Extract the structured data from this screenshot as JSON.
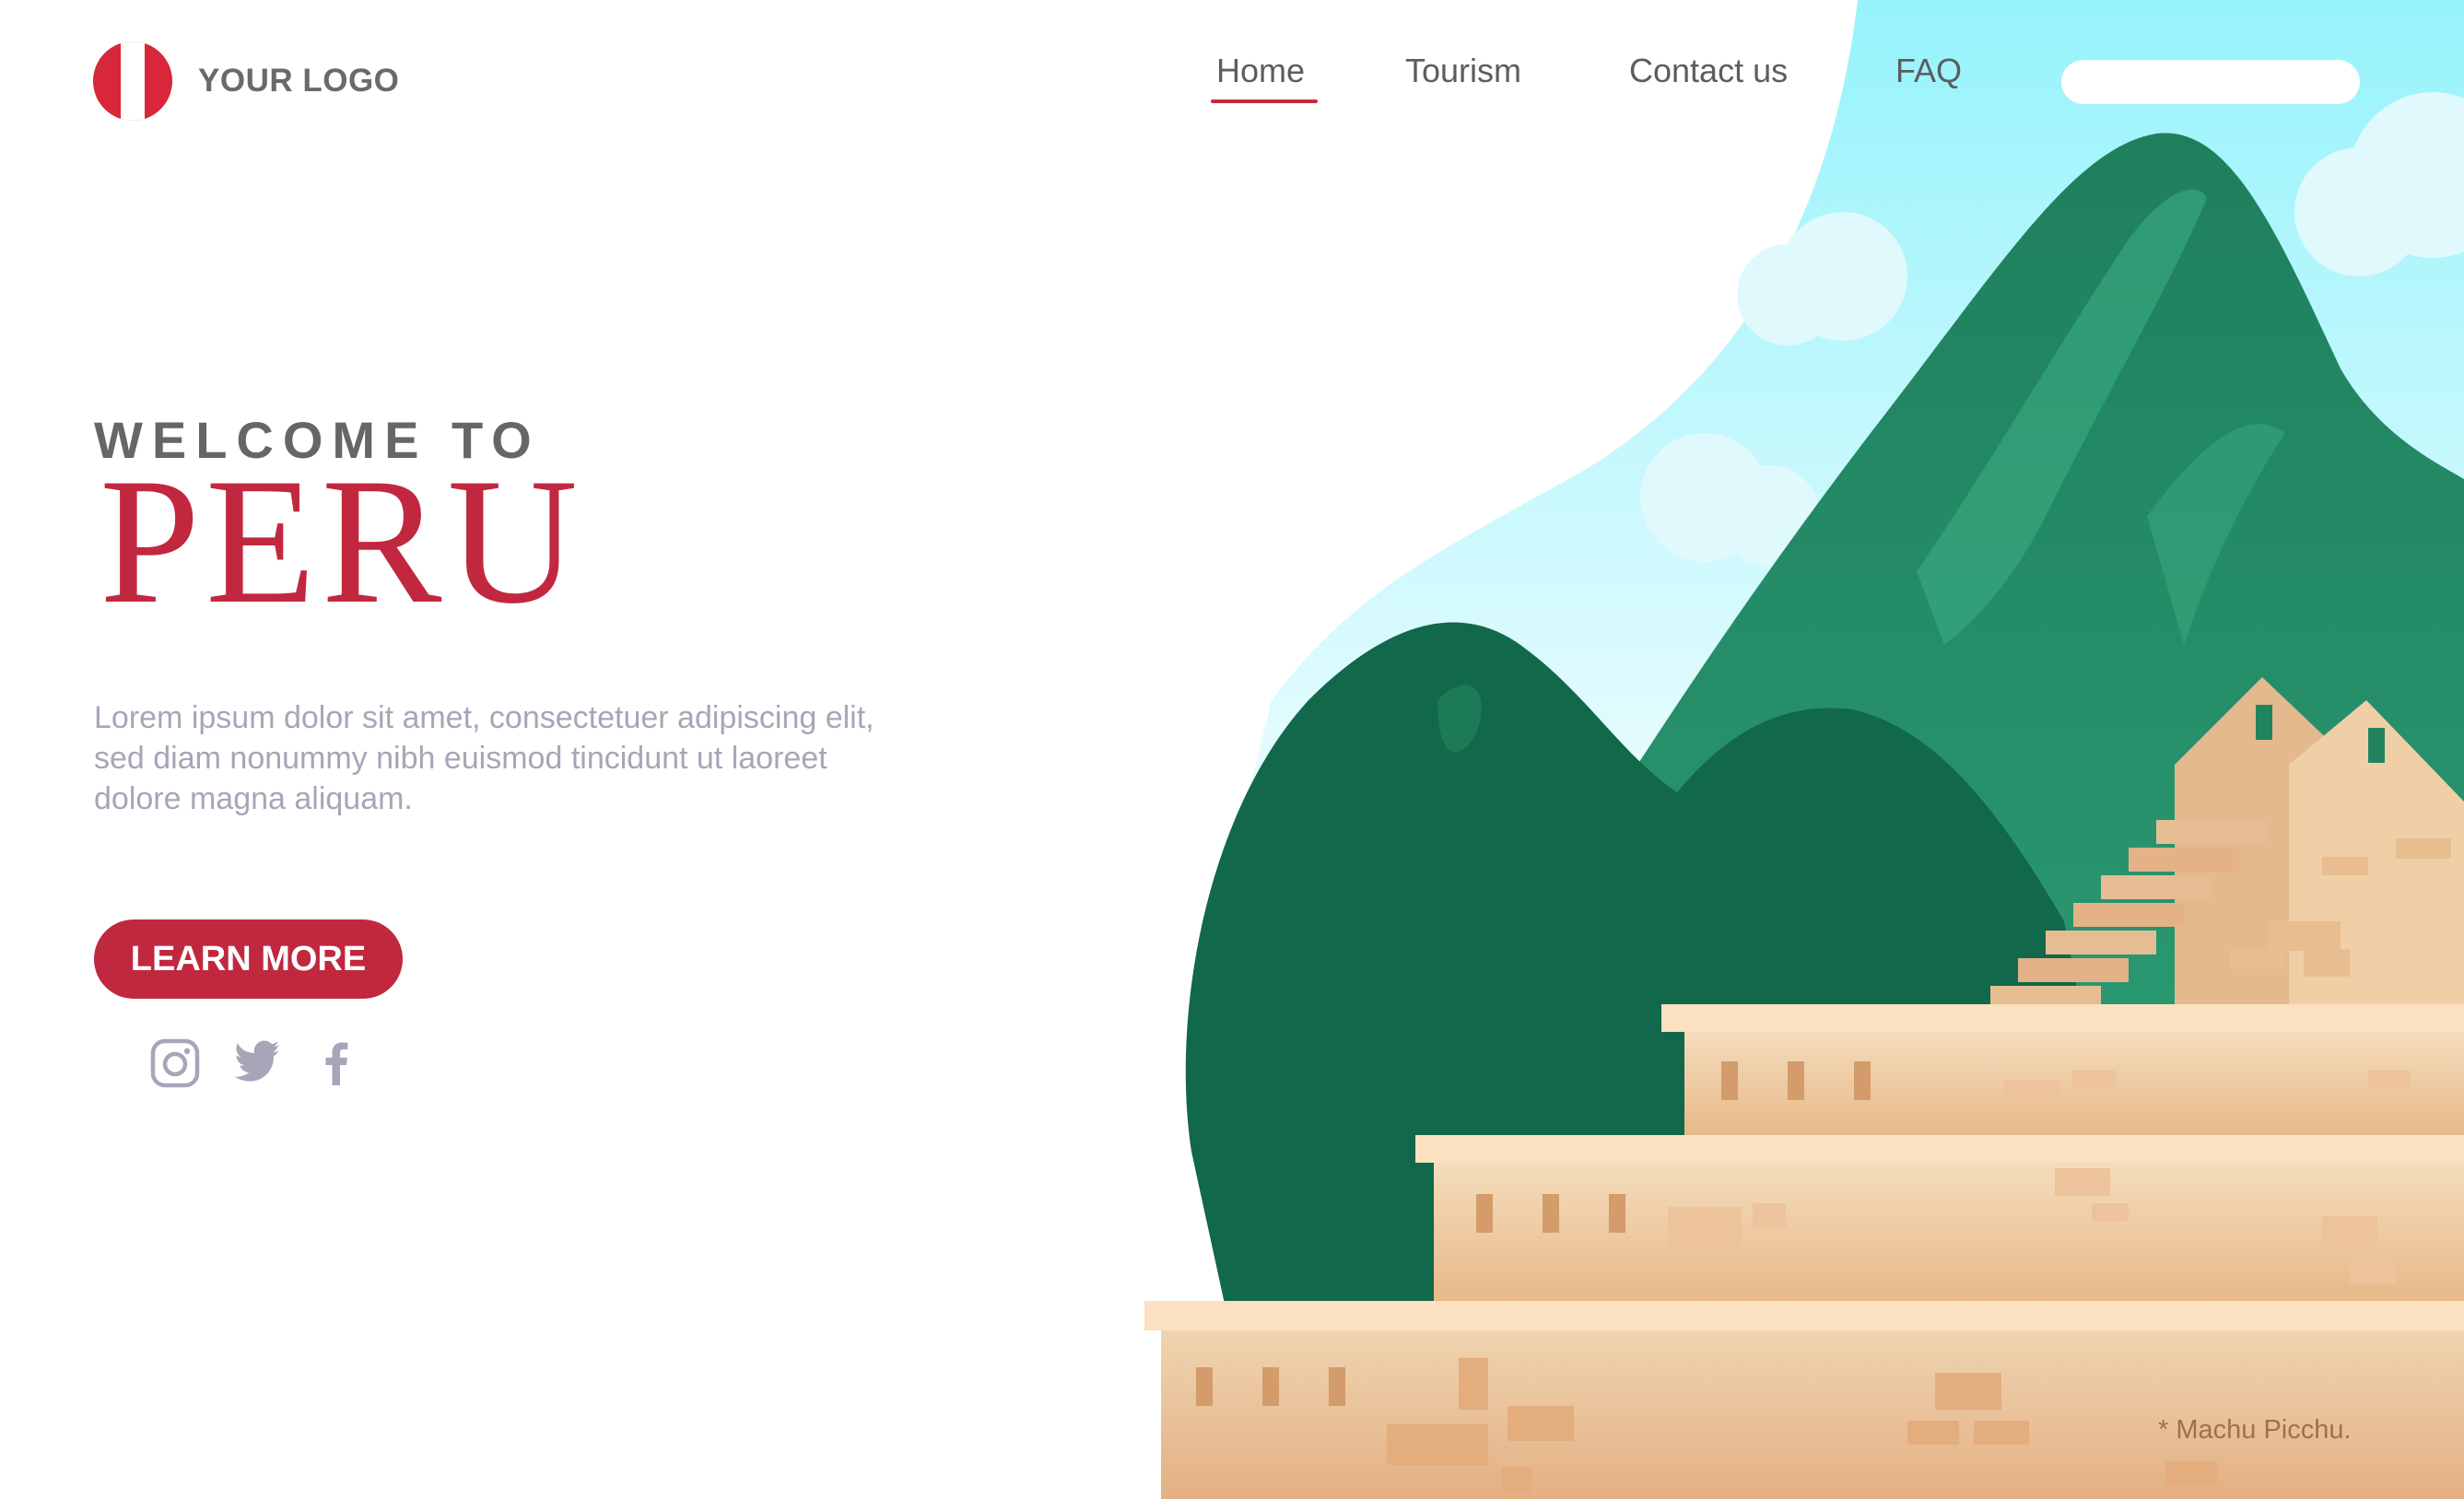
{
  "header": {
    "logo_text": "YOUR LOGO",
    "nav": [
      {
        "label": "Home",
        "active": true
      },
      {
        "label": "Tourism",
        "active": false
      },
      {
        "label": "Contact us",
        "active": false
      },
      {
        "label": "FAQ",
        "active": false
      }
    ],
    "search": {
      "value": "",
      "icon": "search-icon"
    }
  },
  "hero": {
    "kicker": "WELCOME TO",
    "title": "PERU",
    "description": "Lorem ipsum dolor sit amet, consectetuer adipiscing elit, sed diam nonummy nibh euismod tincidunt ut laoreet dolore magna aliquam.",
    "cta_label": "LEARN MORE"
  },
  "social": [
    {
      "icon": "instagram-icon"
    },
    {
      "icon": "twitter-icon"
    },
    {
      "icon": "facebook-icon"
    }
  ],
  "illustration": {
    "caption": "* Machu Picchu."
  },
  "colors": {
    "brand_red": "#c1283f",
    "nav_underline": "#c8283f",
    "sky": "#9ef4fb",
    "mountain_green": "#2f9a72",
    "mountain_dark": "#11684a",
    "stone": "#f1cea6"
  }
}
